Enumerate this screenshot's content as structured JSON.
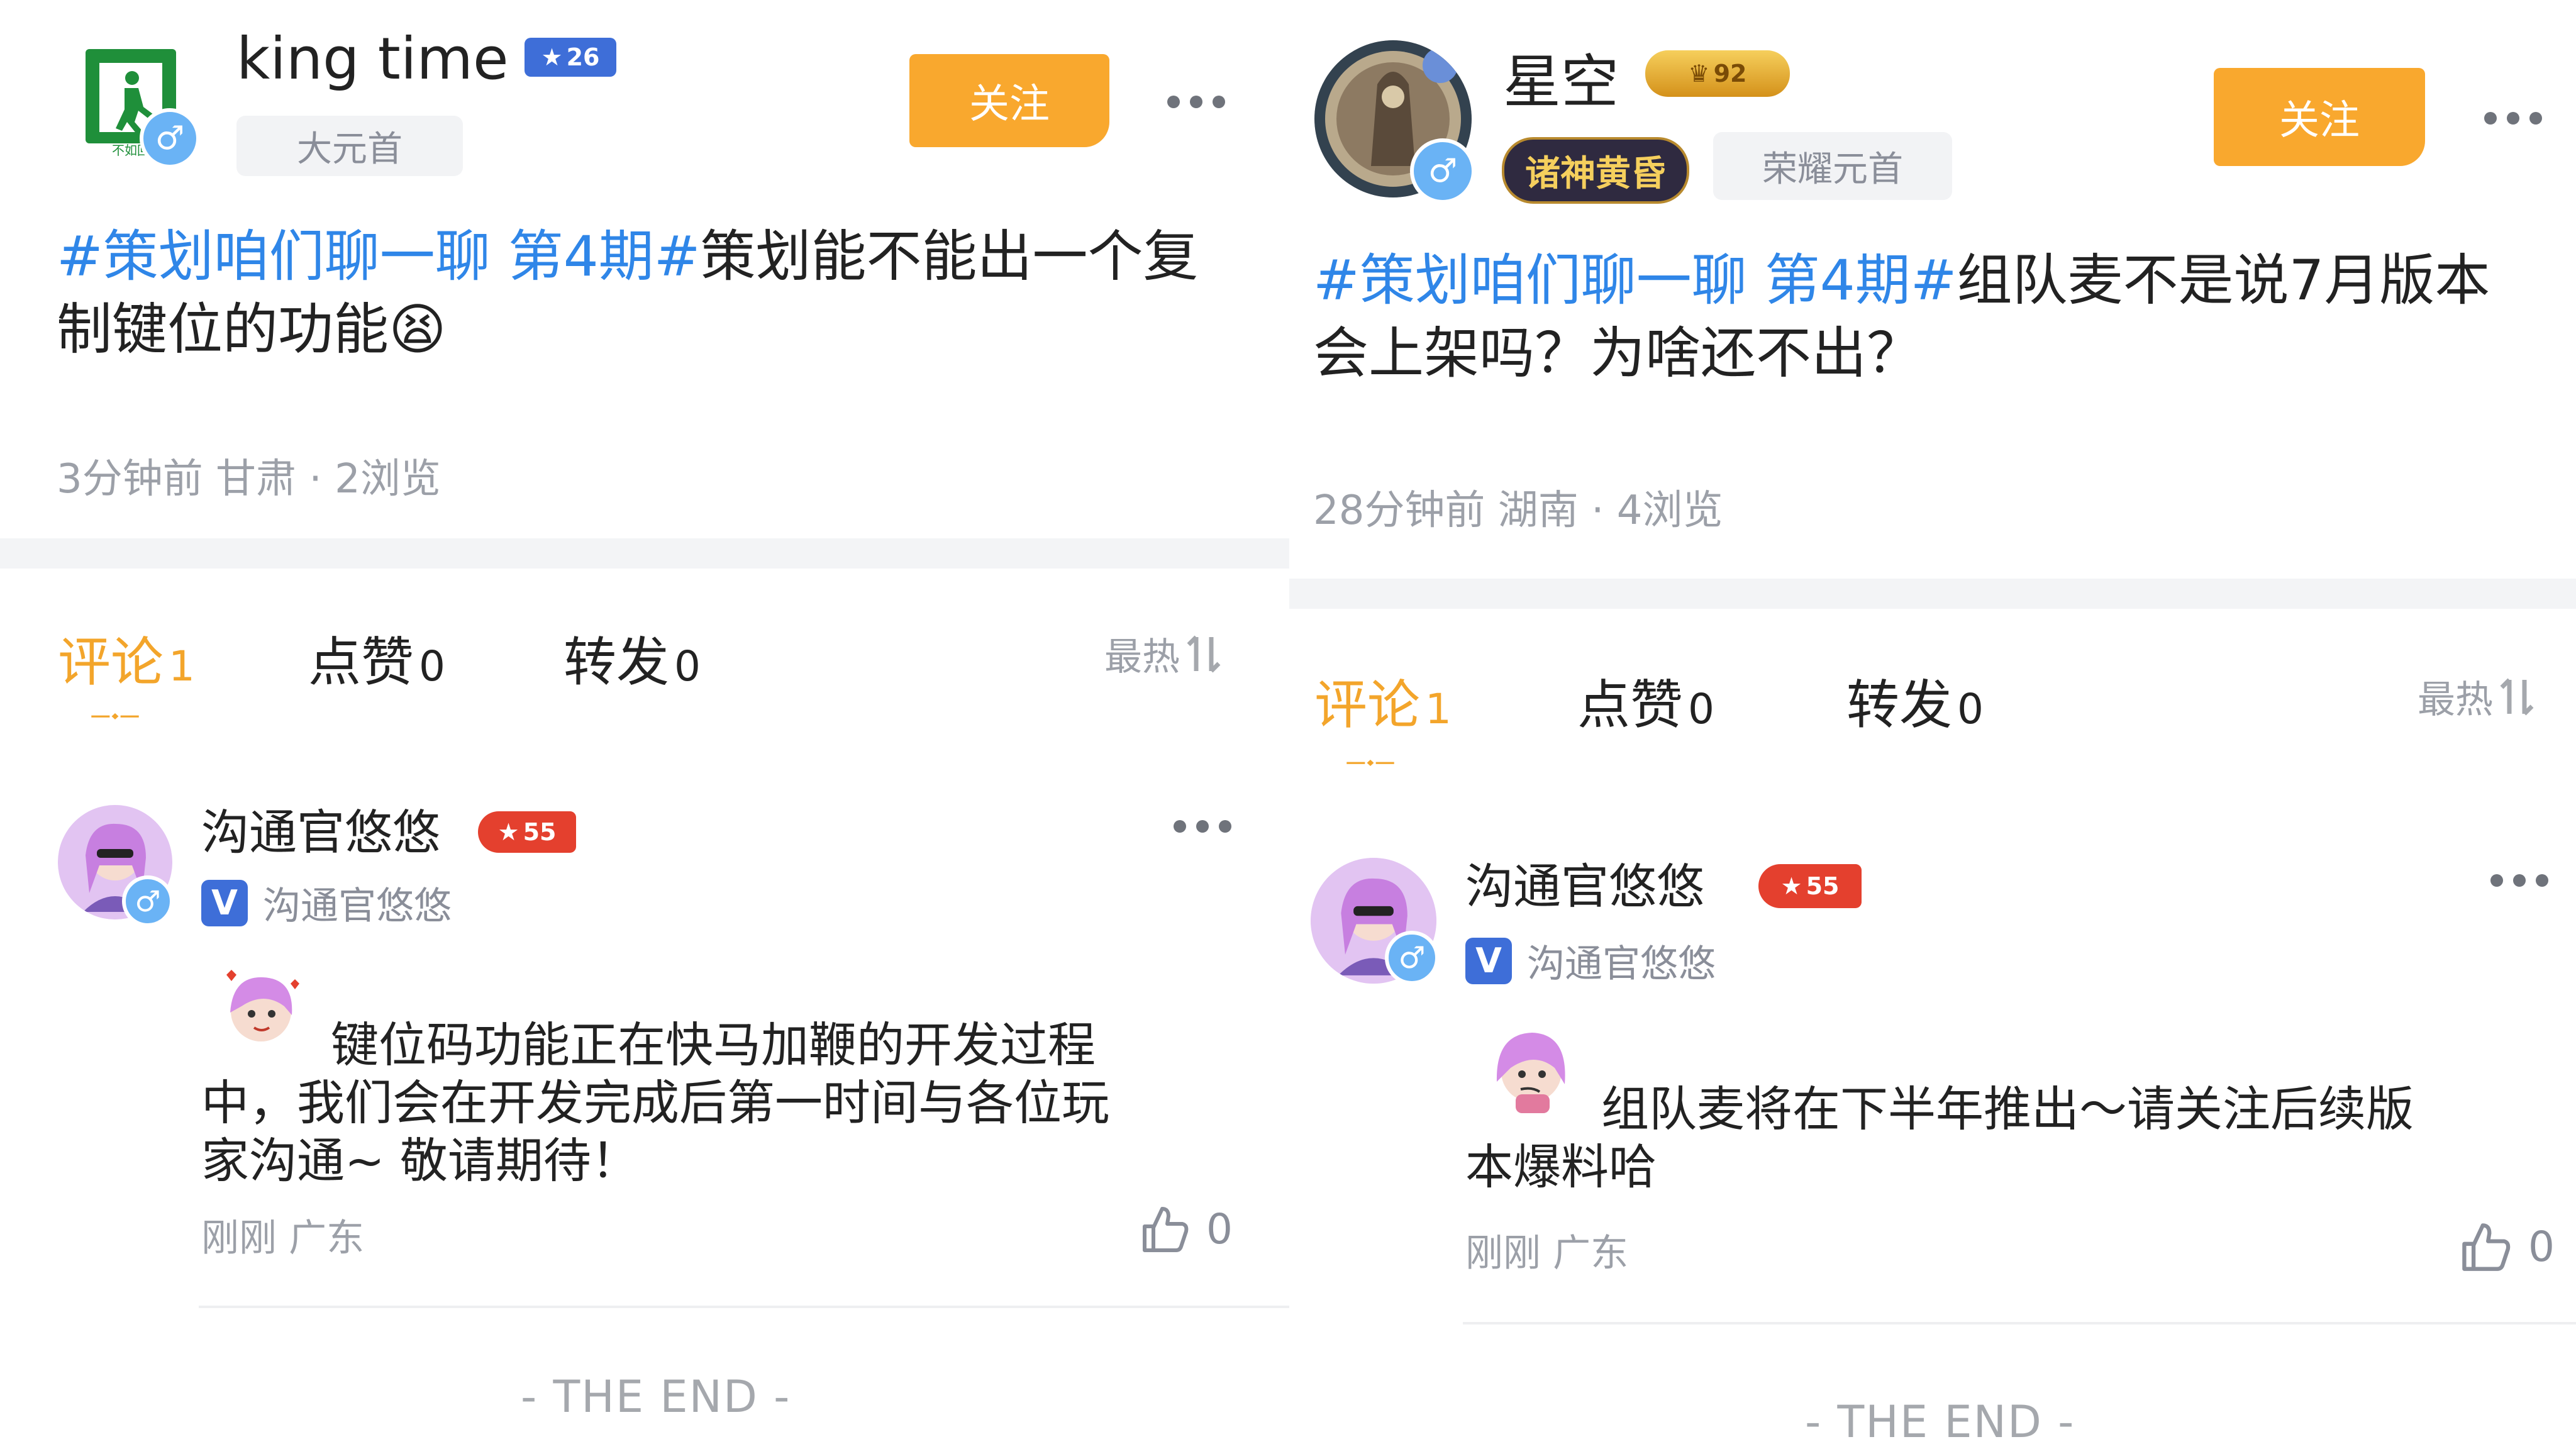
{
  "left": {
    "author": {
      "name": "king  time",
      "level": "26",
      "title": "大元首"
    },
    "follow_label": "关注",
    "post": {
      "topic": "#策划咱们聊一聊 第4期#",
      "body": "策划能不能出一个复制键位的功能",
      "emoji": "😫"
    },
    "meta": "3分钟前 甘肃 · 2浏览",
    "tabs": [
      {
        "label": "评论",
        "count": "1"
      },
      {
        "label": "点赞",
        "count": "0"
      },
      {
        "label": "转发",
        "count": "0"
      }
    ],
    "sort_label": "最热",
    "comment": {
      "name": "沟通官悠悠",
      "level": "55",
      "rank": "沟通官悠悠",
      "text": "键位码功能正在快马加鞭的开发过程中，我们会在开发完成后第一时间与各位玩家沟通~ 敬请期待！",
      "time": "刚刚  广东",
      "likes": "0"
    },
    "end_text": "- THE END -"
  },
  "right": {
    "author": {
      "name": "星空",
      "level": "92",
      "title": "荣耀元首",
      "honor": "诸神黄昏"
    },
    "follow_label": "关注",
    "post": {
      "topic": "#策划咱们聊一聊 第4期#",
      "body": "组队麦不是说7月版本会上架吗？为啥还不出？"
    },
    "meta": "28分钟前 湖南 · 4浏览",
    "tabs": [
      {
        "label": "评论",
        "count": "1"
      },
      {
        "label": "点赞",
        "count": "0"
      },
      {
        "label": "转发",
        "count": "0"
      }
    ],
    "sort_label": "最热",
    "comment": {
      "name": "沟通官悠悠",
      "level": "55",
      "rank": "沟通官悠悠",
      "text": "组队麦将在下半年推出～请关注后续版本爆料哈",
      "time": "刚刚  广东",
      "likes": "0"
    },
    "end_text": "- THE END -"
  },
  "colors": {
    "accent": "#f3a52b",
    "follow": "#f9a82e",
    "topic": "#2f86e8",
    "meta": "#9ca0a8",
    "male": "#6ab3f5",
    "official_v": "#3e6ed8"
  },
  "icons": {
    "gender": "♂",
    "more": "more-dots-icon",
    "like": "thumb-up-icon",
    "sort": "sort-icon"
  }
}
